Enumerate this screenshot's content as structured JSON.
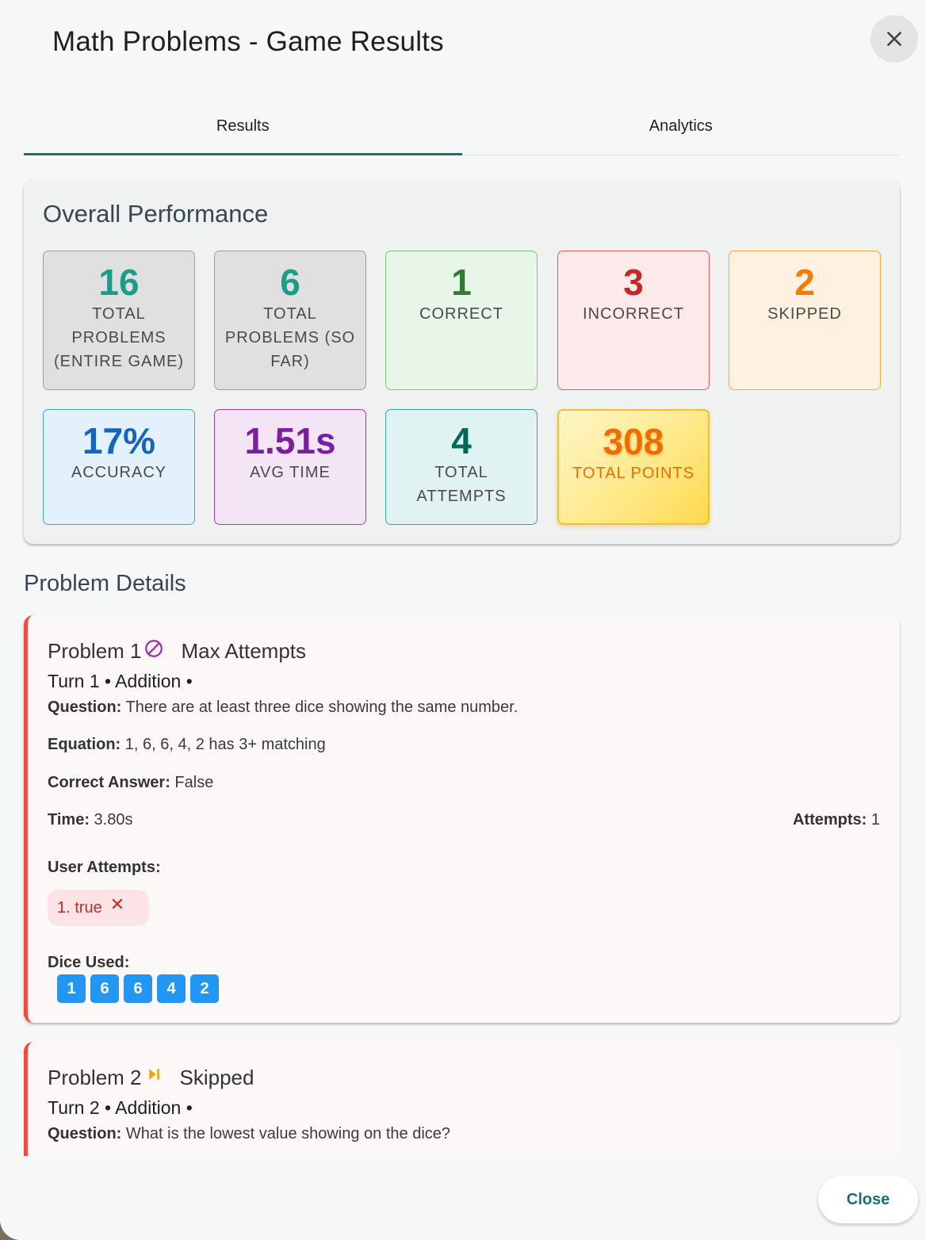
{
  "dialog": {
    "title": "Math Problems - Game Results"
  },
  "tabs": [
    {
      "label": "Results",
      "active": true
    },
    {
      "label": "Analytics",
      "active": false
    }
  ],
  "performance": {
    "title": "Overall Performance",
    "stats": [
      {
        "value": "16",
        "label": "TOTAL PROBLEMS (ENTIRE GAME)",
        "color": "#1e9c8a"
      },
      {
        "value": "6",
        "label": "TOTAL PROBLEMS (SO FAR)",
        "color": "#1e9c8a"
      },
      {
        "value": "1",
        "label": "CORRECT",
        "color": "#2e7d32"
      },
      {
        "value": "3",
        "label": "INCORRECT",
        "color": "#c62828"
      },
      {
        "value": "2",
        "label": "SKIPPED",
        "color": "#f57c00"
      },
      {
        "value": "17%",
        "label": "ACCURACY",
        "color": "#1565c0"
      },
      {
        "value": "1.51s",
        "label": "AVG TIME",
        "color": "#7b1fa2"
      },
      {
        "value": "4",
        "label": "TOTAL ATTEMPTS",
        "color": "#00695c"
      },
      {
        "value": "308",
        "label": "TOTAL POINTS",
        "color": "#ef6c00"
      }
    ]
  },
  "details": {
    "title": "Problem Details",
    "problems": [
      {
        "title": "Problem 1",
        "status_icon": "blocked-icon",
        "status": "Max Attempts",
        "turn": "Turn 1 • Addition •",
        "question_label": "Question:",
        "question": "There are at least three dice showing the same number.",
        "equation_label": "Equation:",
        "equation": "1, 6, 6, 4, 2 has 3+ matching",
        "answer_label": "Correct Answer:",
        "answer": "False",
        "time_label": "Time:",
        "time": "3.80s",
        "attempts_label": "Attempts:",
        "attempts": "1",
        "user_attempts_label": "User Attempts:",
        "user_attempts": [
          {
            "text": "1. true",
            "icon": "close-icon"
          }
        ],
        "dice_label": "Dice Used:",
        "dice": [
          "1",
          "6",
          "6",
          "4",
          "2"
        ]
      },
      {
        "title": "Problem 2",
        "status_icon": "skip-next-icon",
        "status": "Skipped",
        "turn": "Turn 2 • Addition •",
        "question_label": "Question:",
        "question": "What is the lowest value showing on the dice?"
      }
    ]
  },
  "footer": {
    "close_label": "Close"
  },
  "colors": {
    "accent": "#18716b",
    "card_border": "#ef4b3f",
    "die": "#2196f3"
  }
}
